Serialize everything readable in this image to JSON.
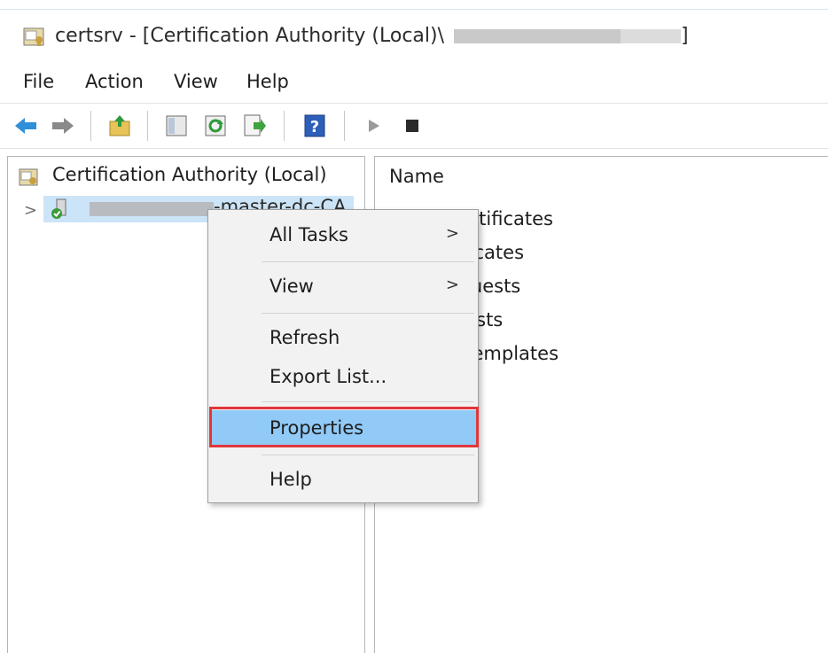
{
  "window": {
    "title_prefix": "certsrv - [Certification Authority (Local)\\",
    "title_suffix": "]"
  },
  "menubar": {
    "items": [
      "File",
      "Action",
      "View",
      "Help"
    ]
  },
  "toolbar": {
    "icons": [
      "back-arrow-icon",
      "forward-arrow-icon",
      "up-folder-icon",
      "show-hide-console-tree-icon",
      "refresh-icon",
      "export-list-icon",
      "help-icon",
      "start-service-icon",
      "stop-service-icon"
    ]
  },
  "tree": {
    "root_label": "Certification Authority (Local)",
    "child_label_visible": "-master-dc-CA",
    "expander": ">"
  },
  "list": {
    "column_header": "Name",
    "items": [
      "ed Certificates",
      "Certificates",
      "g Requests",
      "Requests",
      "cate Templates"
    ]
  },
  "context_menu": {
    "items": [
      {
        "label": "All Tasks",
        "submenu": true
      },
      {
        "label": "View",
        "submenu": true
      },
      {
        "label": "Refresh",
        "submenu": false
      },
      {
        "label": "Export List...",
        "submenu": false
      },
      {
        "label": "Properties",
        "submenu": false,
        "highlighted": true
      },
      {
        "label": "Help",
        "submenu": false
      }
    ],
    "submenu_arrow": ">"
  },
  "colors": {
    "selection": "#cce4f7",
    "menu_highlight": "#91c9f7",
    "annotation_red": "#e0373a"
  }
}
